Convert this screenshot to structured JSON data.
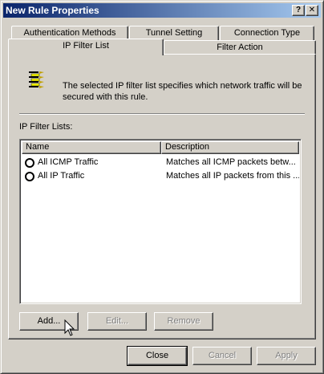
{
  "window": {
    "title": "New Rule Properties"
  },
  "titlebar": {
    "help_label": "?",
    "close_label": "✕"
  },
  "tabs": {
    "row1": [
      {
        "label": "Authentication Methods"
      },
      {
        "label": "Tunnel Setting"
      },
      {
        "label": "Connection Type"
      }
    ],
    "row2": [
      {
        "label": "IP Filter List",
        "selected": true
      },
      {
        "label": "Filter Action"
      }
    ]
  },
  "panel": {
    "icon": "ip-filter-list-icon",
    "description": "The selected IP filter list specifies which network traffic will be secured with this rule.",
    "lists_label": "IP Filter Lists:",
    "columns": [
      "Name",
      "Description"
    ],
    "rows": [
      {
        "name": "All ICMP Traffic",
        "description": "Matches all ICMP packets betw..."
      },
      {
        "name": "All IP Traffic",
        "description": "Matches all IP packets from this ..."
      }
    ],
    "buttons": {
      "add": "Add...",
      "edit": "Edit...",
      "remove": "Remove"
    }
  },
  "footer": {
    "close": "Close",
    "cancel": "Cancel",
    "apply": "Apply"
  },
  "colors": {
    "titlebar_start": "#0a246a",
    "titlebar_end": "#a6caf0",
    "face": "#d4d0c8"
  }
}
